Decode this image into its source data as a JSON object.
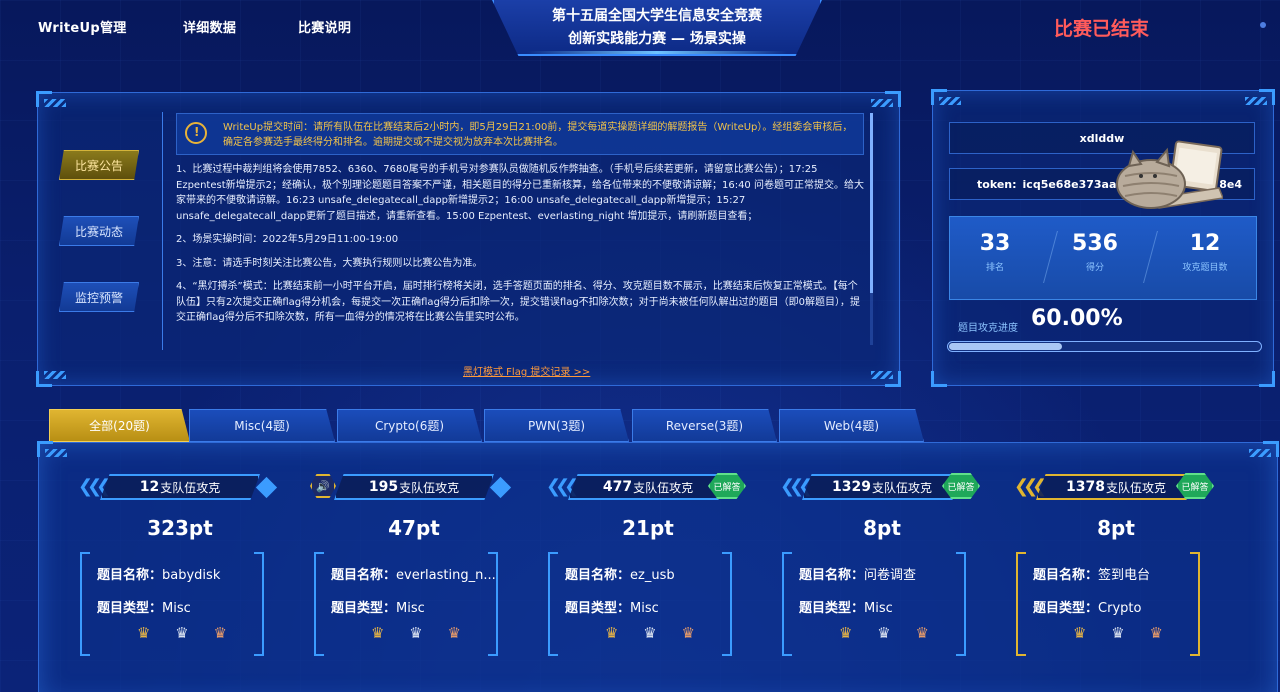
{
  "nav": {
    "writeup": "WriteUp管理",
    "details": "详细数据",
    "rules": "比赛说明",
    "title_line1": "第十五届全国大学生信息安全竞赛",
    "title_line2": "创新实践能力赛 — 场景实操",
    "status": "比赛已结束"
  },
  "sidebar": {
    "items": [
      {
        "label": "比赛公告",
        "active": true
      },
      {
        "label": "比赛动态",
        "active": false
      },
      {
        "label": "监控预警",
        "active": false
      }
    ]
  },
  "announcement": {
    "notice": "WriteUp提交时间：请所有队伍在比赛结束后2小时内，即5月29日21:00前，提交每道实操题详细的解题报告（WriteUp）。经组委会审核后，确定各参赛选手最终得分和排名。逾期提交或不提交视为放弃本次比赛排名。",
    "items": [
      "1、比赛过程中裁判组将会使用7852、6360、7680尾号的手机号对参赛队员做随机反作弊抽查。（手机号后续若更新，请留意比赛公告）；17:25 Ezpentest新增提示2；经确认，极个别理论题题目答案不严谨，相关题目的得分已重新核算，给各位带来的不便敬请谅解；16:40 问卷题可正常提交。给大家带来的不便敬请谅解。16:23 unsafe_delegatecall_dapp新增提示2；16:00 unsafe_delegatecall_dapp新增提示；15:27 unsafe_delegatecall_dapp更新了题目描述，请重新查看。15:00 Ezpentest、everlasting_night 增加提示，请刷新题目查看；",
      "2、场景实操时间：2022年5月29日11:00-19:00",
      "3、注意：请选手时刻关注比赛公告，大赛执行规则以比赛公告为准。",
      "4、“黑灯搏杀”模式：比赛结束前一小时平台开启，届时排行榜将关闭，选手答题页面的排名、得分、攻克题目数不展示，比赛结束后恢复正常模式。【每个队伍】只有2次提交正确flag得分机会，每提交一次正确flag得分后扣除一次，提交错误flag不扣除次数；对于尚未被任何队解出过的题目（即0解题目），提交正确flag得分后不扣除次数，所有一血得分的情况将在比赛公告里实时公布。"
    ],
    "blackout_link": "黑灯模式 Flag 提交记录 >>"
  },
  "user": {
    "team_name": "xdlddw",
    "token_label": "token:",
    "token_value": "icq5e68e373aa2",
    "token_tail": "8e4",
    "stats": [
      {
        "value": "33",
        "label": "排名"
      },
      {
        "value": "536",
        "label": "得分"
      },
      {
        "value": "12",
        "label": "攻克题目数"
      }
    ],
    "progress_label": "题目攻克进度",
    "progress_text": "60.00%",
    "progress_fraction": 0.6
  },
  "tabs": [
    {
      "label": "全部(20题)",
      "active": true
    },
    {
      "label": "Misc(4题)",
      "active": false
    },
    {
      "label": "Crypto(6题)",
      "active": false
    },
    {
      "label": "PWN(3题)",
      "active": false
    },
    {
      "label": "Reverse(3题)",
      "active": false
    },
    {
      "label": "Web(4题)",
      "active": false
    }
  ],
  "card_labels": {
    "solves_suffix": "支队伍攻克",
    "name_key": "题目名称：",
    "type_key": "题目类型：",
    "solved_badge": "已解答"
  },
  "challenges": [
    {
      "solves": "12",
      "score": "323pt",
      "name": "babydisk",
      "type": "Misc",
      "solved": false,
      "highlight": "blue"
    },
    {
      "solves": "195",
      "score": "47pt",
      "name": "everlasting_n...",
      "type": "Misc",
      "solved": false,
      "highlight": "blue"
    },
    {
      "solves": "477",
      "score": "21pt",
      "name": "ez_usb",
      "type": "Misc",
      "solved": true,
      "highlight": "blue"
    },
    {
      "solves": "1329",
      "score": "8pt",
      "name": "问卷调查",
      "type": "Misc",
      "solved": true,
      "highlight": "blue"
    },
    {
      "solves": "1378",
      "score": "8pt",
      "name": "签到电台",
      "type": "Crypto",
      "solved": true,
      "highlight": "gold"
    }
  ],
  "icons": {
    "crown": "♛",
    "sound": "🔊"
  },
  "colors": {
    "accent_blue": "#3b9cff",
    "gold": "#e0b531",
    "status_red": "#ff5b5b",
    "solved_green": "#1fa85a"
  }
}
